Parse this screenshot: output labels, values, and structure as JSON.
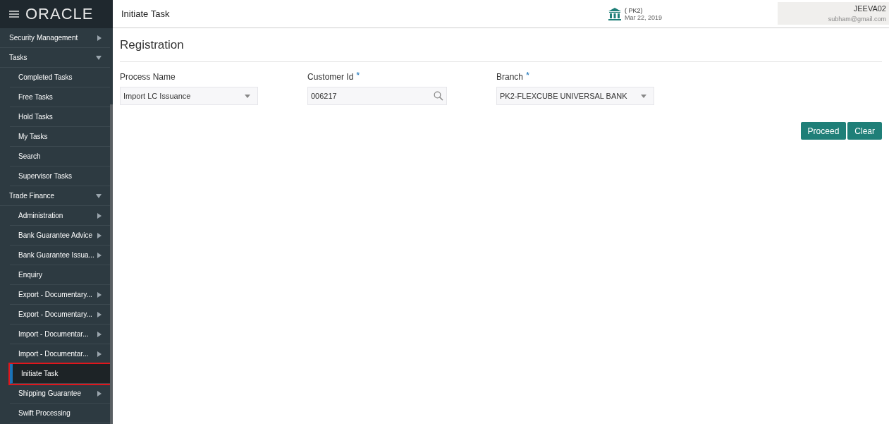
{
  "brand": {
    "logo": "ORACLE"
  },
  "header": {
    "title": "Initiate Task",
    "branch_code": "( PK2)",
    "date": "Mar 22, 2019",
    "user": "JEEVA02",
    "email": "subham@gmail.com"
  },
  "sidebar": {
    "items": [
      {
        "label": "Security Management",
        "submenu": true,
        "expanded": false,
        "selected": false
      },
      {
        "label": "Tasks",
        "submenu": true,
        "expanded": true,
        "selected": false,
        "children": [
          {
            "label": "Completed Tasks",
            "submenu": false,
            "selected": false
          },
          {
            "label": "Free Tasks",
            "submenu": false,
            "selected": false
          },
          {
            "label": "Hold Tasks",
            "submenu": false,
            "selected": false
          },
          {
            "label": "My Tasks",
            "submenu": false,
            "selected": false
          },
          {
            "label": "Search",
            "submenu": false,
            "selected": false
          },
          {
            "label": "Supervisor Tasks",
            "submenu": false,
            "selected": false
          }
        ]
      },
      {
        "label": "Trade Finance",
        "submenu": true,
        "expanded": true,
        "selected": false,
        "children": [
          {
            "label": "Administration",
            "submenu": true,
            "selected": false
          },
          {
            "label": "Bank Guarantee Advice",
            "submenu": true,
            "selected": false
          },
          {
            "label": "Bank Guarantee Issua...",
            "submenu": true,
            "selected": false
          },
          {
            "label": "Enquiry",
            "submenu": false,
            "selected": false
          },
          {
            "label": "Export - Documentary...",
            "submenu": true,
            "selected": false
          },
          {
            "label": "Export - Documentary...",
            "submenu": true,
            "selected": false
          },
          {
            "label": "Import - Documentar...",
            "submenu": true,
            "selected": false
          },
          {
            "label": "Import - Documentar...",
            "submenu": true,
            "selected": false
          },
          {
            "label": "Initiate Task",
            "submenu": false,
            "selected": true
          },
          {
            "label": "Shipping Guarantee",
            "submenu": true,
            "selected": false
          },
          {
            "label": "Swift Processing",
            "submenu": false,
            "selected": false
          }
        ]
      }
    ]
  },
  "form": {
    "title": "Registration",
    "fields": [
      {
        "kind": "select",
        "label": "Process Name",
        "required": false,
        "value": "Import LC Issuance"
      },
      {
        "kind": "search",
        "label": "Customer Id",
        "required": true,
        "value": "006217"
      },
      {
        "kind": "select",
        "label": "Branch",
        "required": true,
        "value": "PK2-FLEXCUBE UNIVERSAL BANK"
      }
    ],
    "required_mark": "*",
    "buttons": [
      "Proceed",
      "Clear"
    ]
  }
}
